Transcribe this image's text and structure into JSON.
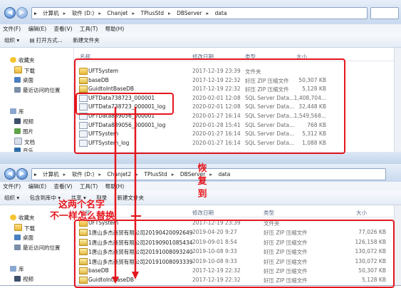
{
  "window_top": {
    "path": [
      "计算机",
      "软件 (D:)",
      "Chanjet",
      "TPlusStd",
      "DBServer",
      "data"
    ],
    "menu": [
      "文件(F)",
      "编辑(E)",
      "查看(V)",
      "工具(T)",
      "帮助(H)"
    ],
    "toolbar": [
      "组织 ▾",
      "打开方式...",
      "新建文件夹"
    ],
    "sidebar": [
      {
        "label": "收藏夹",
        "icon": "star-icon"
      },
      {
        "label": "下载",
        "icon": "download-folder-icon"
      },
      {
        "label": "桌面",
        "icon": "desktop-icon"
      },
      {
        "label": "最近访问的位置",
        "icon": "recent-places-icon"
      },
      {
        "label": "库",
        "icon": "library-icon"
      },
      {
        "label": "视频",
        "icon": "video-icon"
      },
      {
        "label": "图片",
        "icon": "pictures-icon"
      },
      {
        "label": "文档",
        "icon": "documents-icon"
      },
      {
        "label": "音乐",
        "icon": "music-icon"
      }
    ],
    "columns": [
      "名称",
      "修改日期",
      "类型",
      "大小"
    ],
    "files": [
      {
        "name": "UFTSystem",
        "date": "2017-12-19 23:39",
        "type": "文件夹",
        "size": "",
        "icon": "folder"
      },
      {
        "name": "baseDB",
        "date": "2017-12-19 22:32",
        "type": "好压 ZIP 压缩文件",
        "size": "50,307 KB",
        "icon": "zip"
      },
      {
        "name": "GuidtoIntBaseDB",
        "date": "2017-12-19 22:32",
        "type": "好压 ZIP 压缩文件",
        "size": "5,128 KB",
        "icon": "zip"
      },
      {
        "name": "UFTData738723_000001",
        "date": "2020-02-01 12:08",
        "type": "SQL Server Data...",
        "size": "1,408,704...",
        "icon": "sql"
      },
      {
        "name": "UFTData738723_000001_log",
        "date": "2020-02-01 12:08",
        "type": "SQL Server Data...",
        "size": "32,448 KB",
        "icon": "sql"
      },
      {
        "name": "UFTData889056_000001",
        "date": "2020-01-27 16:14",
        "type": "SQL Server Data...",
        "size": "1,549,568...",
        "icon": "sql"
      },
      {
        "name": "UFTData889056_000001_log",
        "date": "2020-01-28 15:41",
        "type": "SQL Server Data...",
        "size": "768 KB",
        "icon": "sql"
      },
      {
        "name": "UFTSystem",
        "date": "2020-01-27 16:14",
        "type": "SQL Server Data...",
        "size": "5,312 KB",
        "icon": "sql"
      },
      {
        "name": "UFTSystem_log",
        "date": "2020-01-27 16:14",
        "type": "SQL Server Data...",
        "size": "1,088 KB",
        "icon": "sql"
      }
    ]
  },
  "window_bottom": {
    "path": [
      "计算机",
      "软件 (D:)",
      "Chanjet2",
      "TPlusStd",
      "DBServer",
      "data"
    ],
    "menu": [
      "文件(F)",
      "编辑(E)",
      "查看(V)",
      "工具(T)",
      "帮助(H)"
    ],
    "toolbar": [
      "组织 ▾",
      "包含到库中 ▾",
      "共享 ▾",
      "刻录",
      "新建文件夹"
    ],
    "sidebar": [
      {
        "label": "收藏夹",
        "icon": "star-icon"
      },
      {
        "label": "下载",
        "icon": "download-folder-icon"
      },
      {
        "label": "桌面",
        "icon": "desktop-icon"
      },
      {
        "label": "最近访问的位置",
        "icon": "recent-places-icon"
      },
      {
        "label": "库",
        "icon": "library-icon"
      },
      {
        "label": "视频",
        "icon": "video-icon"
      }
    ],
    "columns": [
      "名称",
      "修改日期",
      "类型",
      "大小"
    ],
    "files": [
      {
        "name": "UFTSystem",
        "date": "2017-12-19 23:39",
        "type": "文件夹",
        "size": "",
        "icon": "folder"
      },
      {
        "name": "1唐山多杰商贸有限公司20190420092649",
        "date": "2019-04-20 9:27",
        "type": "好压 ZIP 压缩文件",
        "size": "77,026 KB",
        "icon": "zip"
      },
      {
        "name": "1唐山多杰商贸有限公司20190901085434",
        "date": "2019-09-01 8:54",
        "type": "好压 ZIP 压缩文件",
        "size": "126,158 KB",
        "icon": "zip"
      },
      {
        "name": "1唐山多杰商贸有限公司20191008093240",
        "date": "2019-10-08 9:33",
        "type": "好压 ZIP 压缩文件",
        "size": "130,072 KB",
        "icon": "zip"
      },
      {
        "name": "1唐山多杰商贸有限公司20191008093339",
        "date": "2019-10-08 9:33",
        "type": "好压 ZIP 压缩文件",
        "size": "130,072 KB",
        "icon": "zip"
      },
      {
        "name": "baseDB",
        "date": "2017-12-19 22:32",
        "type": "好压 ZIP 压缩文件",
        "size": "50,307 KB",
        "icon": "zip"
      },
      {
        "name": "GuidtoIntBaseDB",
        "date": "2017-12-19 22:32",
        "type": "好压 ZIP 压缩文件",
        "size": "5,128 KB",
        "icon": "zip"
      }
    ]
  },
  "annotations": {
    "restore_text": [
      "恢",
      "复",
      "到"
    ],
    "rename_line1": "这两个名字",
    "rename_line2": "不一样怎么替换",
    "annotation_color": "#e4161d"
  }
}
